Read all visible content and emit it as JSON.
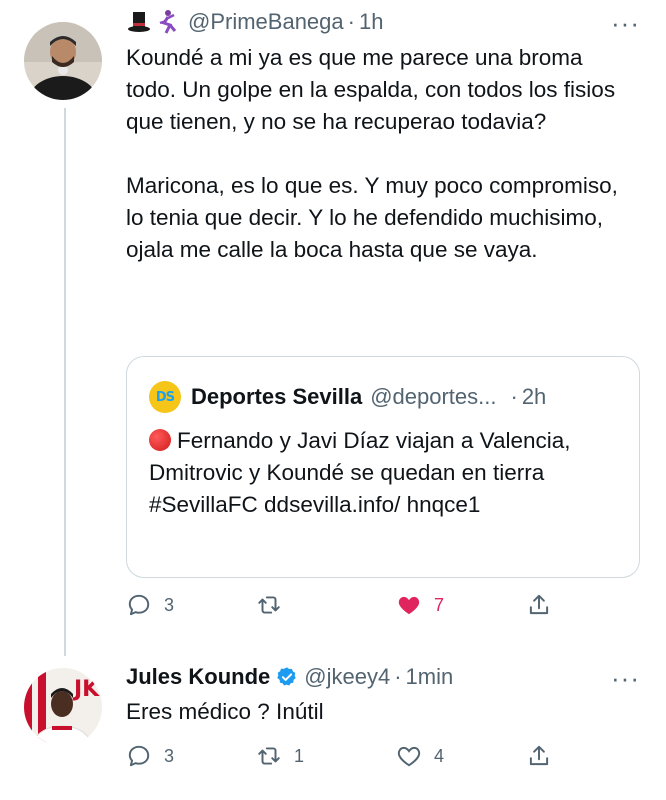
{
  "tweet1": {
    "emoji_prefix": [
      "top-hat-icon",
      "dancer-icon"
    ],
    "handle": "@PrimeBanega",
    "dot": "·",
    "time": "1h",
    "more": "···",
    "paragraphs": [
      "Koundé a mi ya es que me parece una broma todo. Un golpe en la espalda, con todos los fisios que tienen, y no se ha recuperao todavia?",
      "Maricona, es lo que es. Y muy poco compromiso, lo tenia que decir. Y lo he defendido muchisimo, ojala me calle la boca hasta que se vaya."
    ],
    "quote": {
      "logo_text": "DS",
      "display_name": "Deportes Sevilla",
      "handle": "@deportes...",
      "dot": "·",
      "time": "2h",
      "text": "Fernando y Javi Díaz viajan a Valencia, Dmitrovic y Koundé se quedan en tierra #SevillaFC ddsevilla.info/ hnqce1"
    },
    "actions": {
      "reply": "3",
      "retweet": "",
      "like": "7",
      "share": ""
    }
  },
  "tweet2": {
    "display_name": "Jules Kounde",
    "handle": "@jkeey4",
    "dot": "·",
    "time": "1min",
    "more": "···",
    "text": "Eres médico ? Inútil",
    "actions": {
      "reply": "3",
      "retweet": "1",
      "like": "4",
      "share": ""
    }
  },
  "colors": {
    "like_active": "#e0245e",
    "muted": "#536471",
    "verified": "#1d9bf0",
    "border": "#cfd9de"
  }
}
